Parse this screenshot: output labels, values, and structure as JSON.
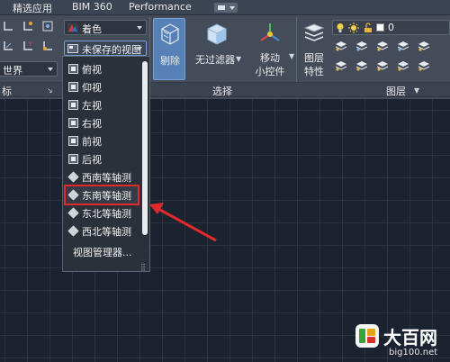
{
  "tabs": [
    {
      "label": "精选应用"
    },
    {
      "label": "BIM 360"
    },
    {
      "label": "Performance"
    }
  ],
  "ribbon": {
    "visual_style_combo": {
      "value": "着色"
    },
    "view_combo": {
      "value": "未保存的视图"
    },
    "coord_combo": {
      "value": "世界"
    },
    "coord_panel_label": "标",
    "cull_button": {
      "label": "剔除"
    },
    "filter_button": {
      "label": "无过滤器"
    },
    "gizmo_button": {
      "label_line1": "移动",
      "label_line2": "小控件"
    },
    "layer_props_button": {
      "label_line1": "图层",
      "label_line2": "特性"
    },
    "layer_combo": {
      "value": "0"
    },
    "select_panel_label": "选择",
    "layer_panel_label": "图层"
  },
  "view_menu": {
    "items": [
      {
        "label": "俯视",
        "icon": "top-view-icon"
      },
      {
        "label": "仰视",
        "icon": "bottom-view-icon"
      },
      {
        "label": "左视",
        "icon": "left-view-icon"
      },
      {
        "label": "右视",
        "icon": "right-view-icon"
      },
      {
        "label": "前视",
        "icon": "front-view-icon"
      },
      {
        "label": "后视",
        "icon": "back-view-icon"
      },
      {
        "label": "西南等轴测",
        "icon": "sw-iso-icon"
      },
      {
        "label": "东南等轴测",
        "icon": "se-iso-icon",
        "highlighted": true
      },
      {
        "label": "东北等轴测",
        "icon": "ne-iso-icon"
      },
      {
        "label": "西北等轴测",
        "icon": "nw-iso-icon"
      }
    ],
    "manager_label": "视图管理器..."
  },
  "watermark": {
    "title": "大百网",
    "url": "big100.net"
  },
  "colors": {
    "accent_blue": "#5780b6",
    "highlight_red": "#e02a2a",
    "canvas_bg": "#1c2330",
    "ribbon_bg": "#444c59"
  }
}
